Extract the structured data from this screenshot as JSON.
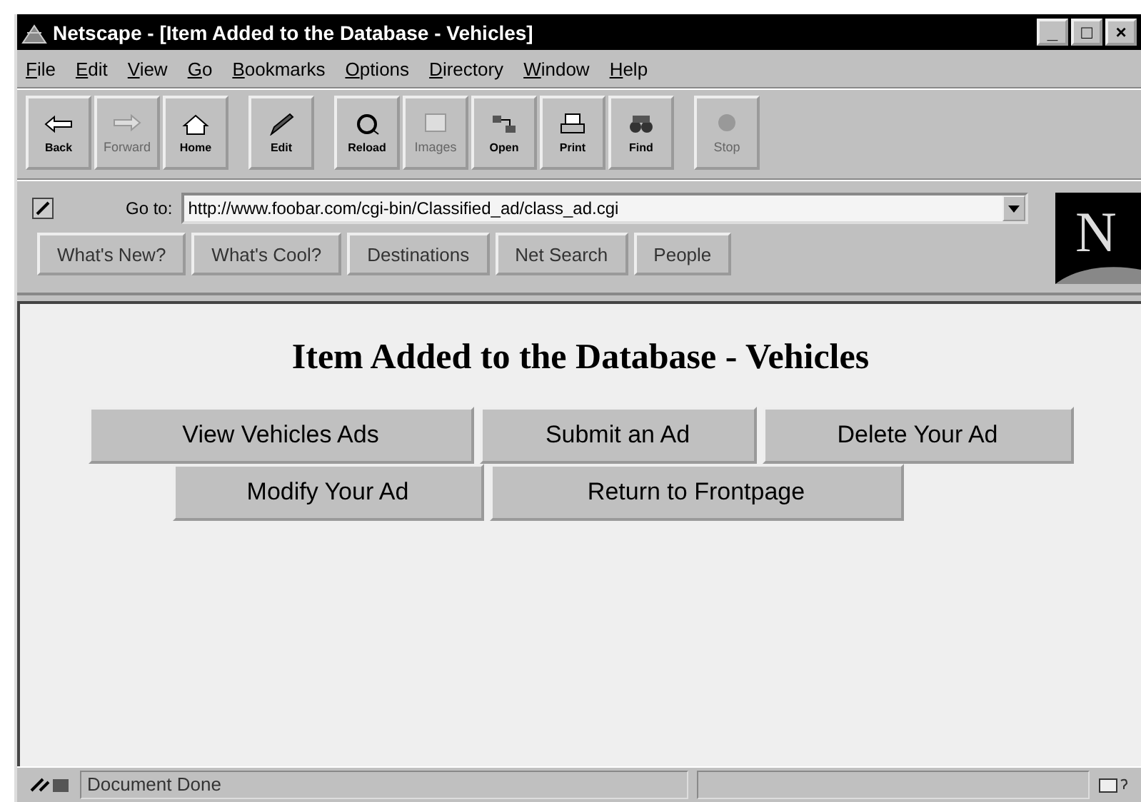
{
  "window": {
    "title": "Netscape - [Item Added to the Database - Vehicles]",
    "controls": [
      "_",
      "□",
      "×"
    ]
  },
  "menu": [
    {
      "label": "File"
    },
    {
      "label": "Edit"
    },
    {
      "label": "View"
    },
    {
      "label": "Go"
    },
    {
      "label": "Bookmarks"
    },
    {
      "label": "Options"
    },
    {
      "label": "Directory"
    },
    {
      "label": "Window"
    },
    {
      "label": "Help"
    }
  ],
  "toolbar": [
    {
      "kind": "back",
      "label": "Back",
      "disabled": false
    },
    {
      "kind": "forward",
      "label": "Forward",
      "disabled": true
    },
    {
      "kind": "home",
      "label": "Home",
      "disabled": false
    },
    {
      "kind": "edit",
      "label": "Edit",
      "disabled": false
    },
    {
      "kind": "reload",
      "label": "Reload",
      "disabled": false
    },
    {
      "kind": "images",
      "label": "Images",
      "disabled": true
    },
    {
      "kind": "open",
      "label": "Open",
      "disabled": false
    },
    {
      "kind": "print",
      "label": "Print",
      "disabled": false
    },
    {
      "kind": "find",
      "label": "Find",
      "disabled": false
    },
    {
      "kind": "stop",
      "label": "Stop",
      "disabled": true
    }
  ],
  "location": {
    "label": "Go to:",
    "value": "http://www.foobar.com/cgi-bin/Classified_ad/class_ad.cgi"
  },
  "directory_buttons": [
    "What's New?",
    "What's Cool?",
    "Destinations",
    "Net Search",
    "People"
  ],
  "logo": "N",
  "page": {
    "heading": "Item Added to the Database - Vehicles",
    "button_rows": [
      [
        "View Vehicles Ads",
        "Submit an Ad",
        "Delete Your Ad"
      ],
      [
        "Modify Your Ad",
        "Return to Frontpage"
      ]
    ]
  },
  "status_bar": {
    "text": "Document Done"
  }
}
